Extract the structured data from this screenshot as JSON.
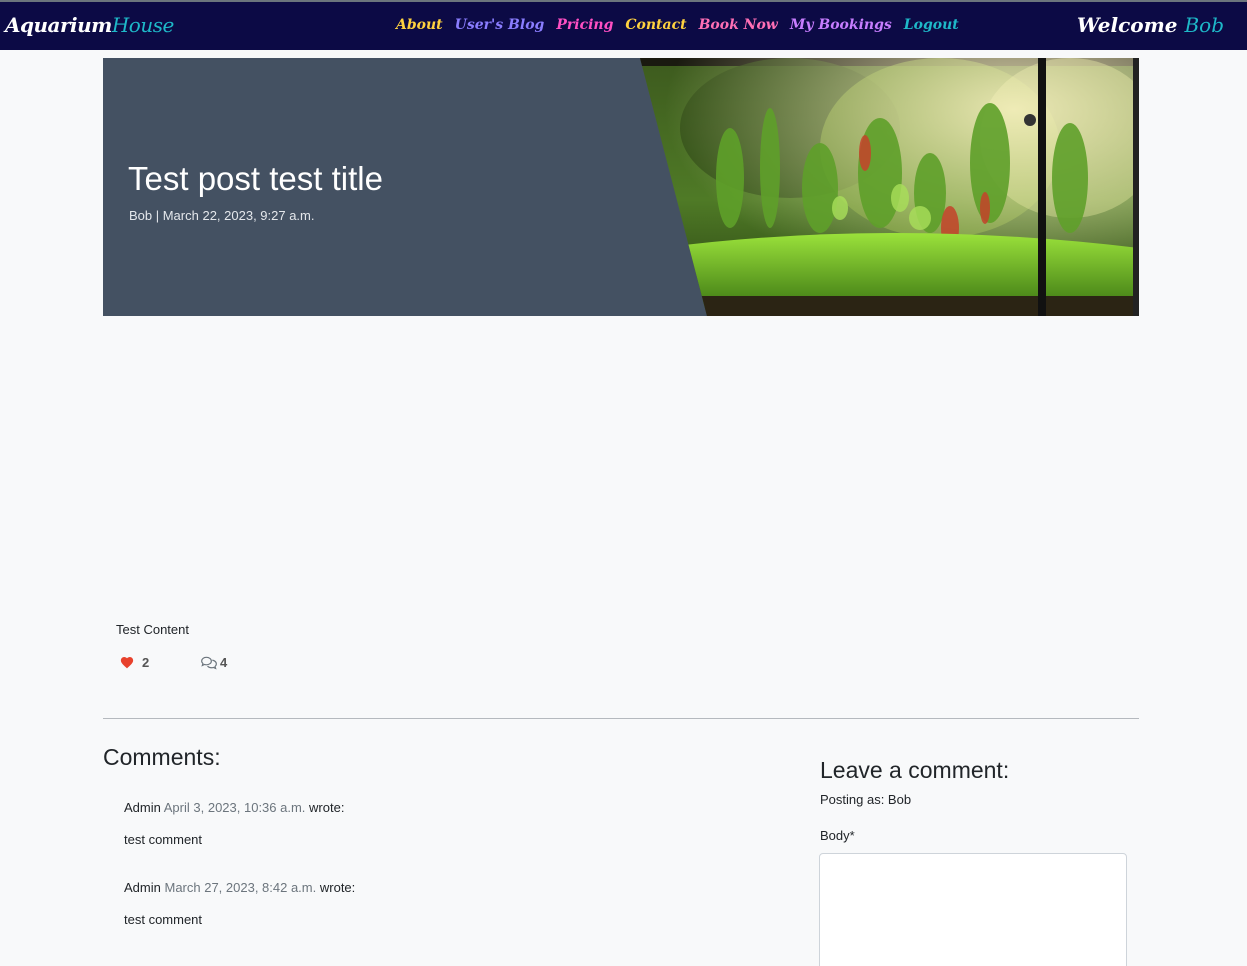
{
  "brand": {
    "part1": "Aquarium",
    "part2": "House"
  },
  "nav": {
    "items": [
      {
        "label": "About",
        "color": "#ffd23f"
      },
      {
        "label": "User's Blog",
        "color": "#8a7dff"
      },
      {
        "label": "Pricing",
        "color": "#ff4fc3"
      },
      {
        "label": "Contact",
        "color": "#ffd23f"
      },
      {
        "label": "Book Now",
        "color": "#ff6fb5"
      },
      {
        "label": "My Bookings",
        "color": "#c77dff"
      },
      {
        "label": "Logout",
        "color": "#1eb8c8"
      }
    ]
  },
  "welcome": {
    "part1": "Welcome",
    "part2": "Bob"
  },
  "post": {
    "title": "Test post test title",
    "meta": "Bob | March 22, 2023, 9:27 a.m.",
    "content": "Test Content",
    "likes": "2",
    "comment_count": "4"
  },
  "comments": {
    "heading": "Comments:",
    "items": [
      {
        "author": "Admin",
        "date": "April 3, 2023, 10:36 a.m.",
        "wrote": "wrote:",
        "body": "test comment"
      },
      {
        "author": "Admin",
        "date": "March 27, 2023, 8:42 a.m.",
        "wrote": "wrote:",
        "body": "test comment"
      }
    ]
  },
  "comment_form": {
    "heading": "Leave a comment:",
    "posting_as": "Posting as: Bob",
    "body_label": "Body*",
    "body_value": ""
  },
  "colors": {
    "navbar": "#0c0a45",
    "hero_panel": "#445162",
    "accent": "#1eb8c8",
    "like": "#e8412c"
  }
}
